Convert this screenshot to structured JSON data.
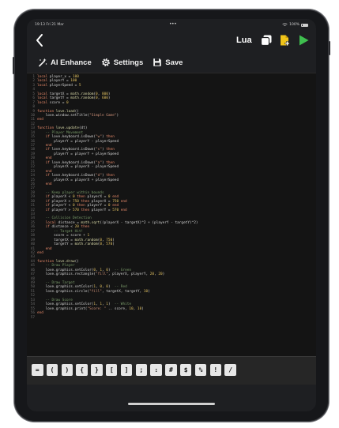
{
  "status_bar": {
    "time": "19:13  Fri 21 Mar",
    "dots": "•••",
    "battery": "100%"
  },
  "nav": {
    "language": "Lua",
    "back_icon": "chevron-left-icon"
  },
  "toolbar": {
    "ai_label": "AI Enhance",
    "settings_label": "Settings",
    "save_label": "Save"
  },
  "code_lines": [
    [
      [
        "kw",
        "local"
      ],
      [
        "id",
        " player_x = "
      ],
      [
        "num",
        "100"
      ]
    ],
    [
      [
        "kw",
        "local"
      ],
      [
        "id",
        " playerY = "
      ],
      [
        "num",
        "100"
      ]
    ],
    [
      [
        "kw",
        "local"
      ],
      [
        "id",
        " playerSpeed = "
      ],
      [
        "num",
        "5"
      ]
    ],
    [
      [
        "id",
        ""
      ]
    ],
    [
      [
        "kw",
        "local"
      ],
      [
        "id",
        " targetX = "
      ],
      [
        "fn",
        "math.random"
      ],
      [
        "id",
        "("
      ],
      [
        "num",
        "0"
      ],
      [
        "id",
        ", "
      ],
      [
        "num",
        "800"
      ],
      [
        "id",
        ")"
      ]
    ],
    [
      [
        "kw",
        "local"
      ],
      [
        "id",
        " targetY = "
      ],
      [
        "fn",
        "math.random"
      ],
      [
        "id",
        "("
      ],
      [
        "num",
        "0"
      ],
      [
        "id",
        ", "
      ],
      [
        "num",
        "600"
      ],
      [
        "id",
        ")"
      ]
    ],
    [
      [
        "kw",
        "local"
      ],
      [
        "id",
        " score = "
      ],
      [
        "num",
        "0"
      ]
    ],
    [
      [
        "id",
        ""
      ]
    ],
    [
      [
        "kw",
        "function"
      ],
      [
        "fn",
        " love.load"
      ],
      [
        "id",
        "()"
      ]
    ],
    [
      [
        "id",
        "    love.window.setTitle("
      ],
      [
        "str",
        "\"Simple Game\""
      ],
      [
        "id",
        ")"
      ]
    ],
    [
      [
        "kw",
        "end"
      ]
    ],
    [
      [
        "id",
        ""
      ]
    ],
    [
      [
        "kw",
        "function"
      ],
      [
        "fn",
        " love.update"
      ],
      [
        "id",
        "(dt)"
      ]
    ],
    [
      [
        "cm",
        "    -- Player Movement"
      ]
    ],
    [
      [
        "kw",
        "    if"
      ],
      [
        "id",
        " love.keyboard.isDown("
      ],
      [
        "str",
        "\"w\""
      ],
      [
        "id",
        ") "
      ],
      [
        "kw",
        "then"
      ]
    ],
    [
      [
        "id",
        "        playerY = playerY - playerSpeed"
      ]
    ],
    [
      [
        "kw",
        "    end"
      ]
    ],
    [
      [
        "kw",
        "    if"
      ],
      [
        "id",
        " love.keyboard.isDown("
      ],
      [
        "str",
        "\"s\""
      ],
      [
        "id",
        ") "
      ],
      [
        "kw",
        "then"
      ]
    ],
    [
      [
        "id",
        "        playerY = playerY + playerSpeed"
      ]
    ],
    [
      [
        "kw",
        "    end"
      ]
    ],
    [
      [
        "kw",
        "    if"
      ],
      [
        "id",
        " love.keyboard.isDown("
      ],
      [
        "str",
        "\"a\""
      ],
      [
        "id",
        ") "
      ],
      [
        "kw",
        "then"
      ]
    ],
    [
      [
        "id",
        "        playerX = playerX - playerSpeed"
      ]
    ],
    [
      [
        "kw",
        "    end"
      ]
    ],
    [
      [
        "kw",
        "    if"
      ],
      [
        "id",
        " love.keyboard.isDown("
      ],
      [
        "str",
        "\"d\""
      ],
      [
        "id",
        ") "
      ],
      [
        "kw",
        "then"
      ]
    ],
    [
      [
        "id",
        "        playerX = playerX + playerSpeed"
      ]
    ],
    [
      [
        "kw",
        "    end"
      ]
    ],
    [
      [
        "id",
        ""
      ]
    ],
    [
      [
        "cm",
        "    -- Keep player within bounds"
      ]
    ],
    [
      [
        "kw",
        "    if"
      ],
      [
        "id",
        " playerX < "
      ],
      [
        "num",
        "0"
      ],
      [
        "kw",
        " then"
      ],
      [
        "id",
        " playerX = "
      ],
      [
        "num",
        "0"
      ],
      [
        "kw",
        " end"
      ]
    ],
    [
      [
        "kw",
        "    if"
      ],
      [
        "id",
        " playerX > "
      ],
      [
        "num",
        "750"
      ],
      [
        "kw",
        " then"
      ],
      [
        "id",
        " playerX = "
      ],
      [
        "num",
        "750"
      ],
      [
        "kw",
        " end"
      ]
    ],
    [
      [
        "kw",
        "    if"
      ],
      [
        "id",
        " playerY < "
      ],
      [
        "num",
        "0"
      ],
      [
        "kw",
        " then"
      ],
      [
        "id",
        " playerY = "
      ],
      [
        "num",
        "0"
      ],
      [
        "kw",
        " end"
      ]
    ],
    [
      [
        "kw",
        "    if"
      ],
      [
        "id",
        " playerY > "
      ],
      [
        "num",
        "570"
      ],
      [
        "kw",
        " then"
      ],
      [
        "id",
        " playerY = "
      ],
      [
        "num",
        "570"
      ],
      [
        "kw",
        " end"
      ]
    ],
    [
      [
        "id",
        ""
      ]
    ],
    [
      [
        "cm",
        "    -- Collision Detection"
      ]
    ],
    [
      [
        "kw",
        "    local"
      ],
      [
        "id",
        " distance = "
      ],
      [
        "fn",
        "math.sqrt"
      ],
      [
        "id",
        "((playerX - targetX)^2 + (playerY - targetY)^2)"
      ]
    ],
    [
      [
        "kw",
        "    if"
      ],
      [
        "id",
        " distance < "
      ],
      [
        "num",
        "20"
      ],
      [
        "kw",
        " then"
      ]
    ],
    [
      [
        "cm",
        "        -- Target Hit!"
      ]
    ],
    [
      [
        "id",
        "        score = score + "
      ],
      [
        "num",
        "1"
      ]
    ],
    [
      [
        "id",
        "        targetX = "
      ],
      [
        "fn",
        "math.random"
      ],
      [
        "id",
        "("
      ],
      [
        "num",
        "0"
      ],
      [
        "id",
        ", "
      ],
      [
        "num",
        "750"
      ],
      [
        "id",
        ")"
      ]
    ],
    [
      [
        "id",
        "        targetY = "
      ],
      [
        "fn",
        "math.random"
      ],
      [
        "id",
        "("
      ],
      [
        "num",
        "0"
      ],
      [
        "id",
        ", "
      ],
      [
        "num",
        "570"
      ],
      [
        "id",
        ")"
      ]
    ],
    [
      [
        "kw",
        "    end"
      ]
    ],
    [
      [
        "kw",
        "end"
      ]
    ],
    [
      [
        "id",
        ""
      ]
    ],
    [
      [
        "kw",
        "function"
      ],
      [
        "fn",
        " love.draw"
      ],
      [
        "id",
        "()"
      ]
    ],
    [
      [
        "cm",
        "    -- Draw Player"
      ]
    ],
    [
      [
        "id",
        "    love.graphics.setColor("
      ],
      [
        "num",
        "0"
      ],
      [
        "id",
        ", "
      ],
      [
        "num",
        "1"
      ],
      [
        "id",
        ", "
      ],
      [
        "num",
        "0"
      ],
      [
        "id",
        ")  "
      ],
      [
        "cm",
        "-- Green"
      ]
    ],
    [
      [
        "id",
        "    love.graphics.rectangle("
      ],
      [
        "str",
        "\"fill\""
      ],
      [
        "id",
        ", playerX, playerY, "
      ],
      [
        "num",
        "20"
      ],
      [
        "id",
        ", "
      ],
      [
        "num",
        "20"
      ],
      [
        "id",
        ")"
      ]
    ],
    [
      [
        "id",
        ""
      ]
    ],
    [
      [
        "cm",
        "    -- Draw Target"
      ]
    ],
    [
      [
        "id",
        "    love.graphics.setColor("
      ],
      [
        "num",
        "1"
      ],
      [
        "id",
        ", "
      ],
      [
        "num",
        "0"
      ],
      [
        "id",
        ", "
      ],
      [
        "num",
        "0"
      ],
      [
        "id",
        ")  "
      ],
      [
        "cm",
        "-- Red"
      ]
    ],
    [
      [
        "id",
        "    love.graphics.circle("
      ],
      [
        "str",
        "\"fill\""
      ],
      [
        "id",
        ", targetX, targetY, "
      ],
      [
        "num",
        "10"
      ],
      [
        "id",
        ")"
      ]
    ],
    [
      [
        "id",
        ""
      ]
    ],
    [
      [
        "cm",
        "    -- Draw Score"
      ]
    ],
    [
      [
        "id",
        "    love.graphics.setColor("
      ],
      [
        "num",
        "1"
      ],
      [
        "id",
        ", "
      ],
      [
        "num",
        "1"
      ],
      [
        "id",
        ", "
      ],
      [
        "num",
        "1"
      ],
      [
        "id",
        ")  "
      ],
      [
        "cm",
        "-- White"
      ]
    ],
    [
      [
        "id",
        "    love.graphics.print("
      ],
      [
        "str",
        "\"Score: \""
      ],
      [
        "id",
        " .. score, "
      ],
      [
        "num",
        "10"
      ],
      [
        "id",
        ", "
      ],
      [
        "num",
        "10"
      ],
      [
        "id",
        ")"
      ]
    ],
    [
      [
        "kw",
        "end"
      ]
    ],
    [
      [
        "id",
        ""
      ]
    ]
  ],
  "symbols": [
    "=",
    "(",
    ")",
    "{",
    "}",
    "[",
    "]",
    ";",
    ":",
    "#",
    "$",
    "%",
    "!",
    "/"
  ],
  "colors": {
    "keyword": "#e88a6a",
    "function": "#dcdcaa",
    "string": "#ce9178",
    "number": "#e0c060",
    "comment": "#7a9b6a",
    "run_button": "#3fbf4f",
    "add_file": "#f0c419"
  }
}
